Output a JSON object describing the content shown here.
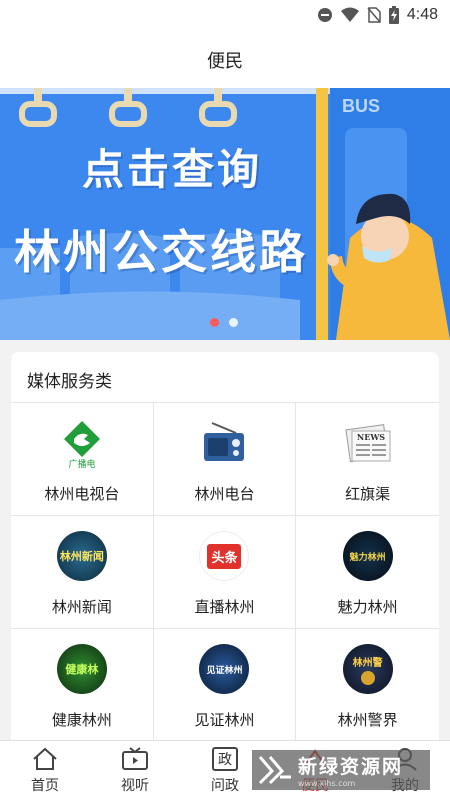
{
  "status": {
    "time": "4:48"
  },
  "header": {
    "title": "便民"
  },
  "banner": {
    "line1": "点击查询",
    "line2": "林州公交线路",
    "sign_text": "BUS",
    "active_slide": 1,
    "slide_count": 2
  },
  "media_section": {
    "title": "媒体服务类",
    "items": [
      {
        "label": "林州电视台",
        "icon": "broadcast-tv-logo-icon"
      },
      {
        "label": "林州电台",
        "icon": "radio-icon"
      },
      {
        "label": "红旗渠",
        "icon": "newspaper-icon"
      },
      {
        "label": "林州新闻",
        "icon": "linzhou-news-icon"
      },
      {
        "label": "直播林州",
        "icon": "toutiao-icon"
      },
      {
        "label": "魅力林州",
        "icon": "charm-linzhou-icon"
      },
      {
        "label": "健康林州",
        "icon": "health-linzhou-icon"
      },
      {
        "label": "见证林州",
        "icon": "witness-linzhou-icon"
      },
      {
        "label": "林州警界",
        "icon": "police-badge-icon"
      }
    ],
    "icon_texts": {
      "tv_logo_caption": "广播电",
      "newspaper_caption": "NEWS",
      "linzhou_news_caption": "林州新闻",
      "toutiao_caption": "头条",
      "charm_caption": "魅力林州",
      "health_caption": "健康林",
      "witness_caption": "见证林州",
      "police_caption": "林州警"
    }
  },
  "tabbar": {
    "tabs": [
      {
        "label": "首页",
        "icon": "home-icon"
      },
      {
        "label": "视听",
        "icon": "tv-icon"
      },
      {
        "label": "问政",
        "icon": "inquiry-icon",
        "icon_glyph": "政"
      },
      {
        "label": "便民",
        "icon": "service-icon",
        "active": true
      },
      {
        "label": "我的",
        "icon": "profile-icon"
      }
    ]
  },
  "watermark": {
    "title": "新绿资源网",
    "url": "www.xlhs.com"
  },
  "colors": {
    "accent_red": "#d9322b",
    "banner_blue": "#3d88ee",
    "tv_green": "#1f9e3a"
  }
}
